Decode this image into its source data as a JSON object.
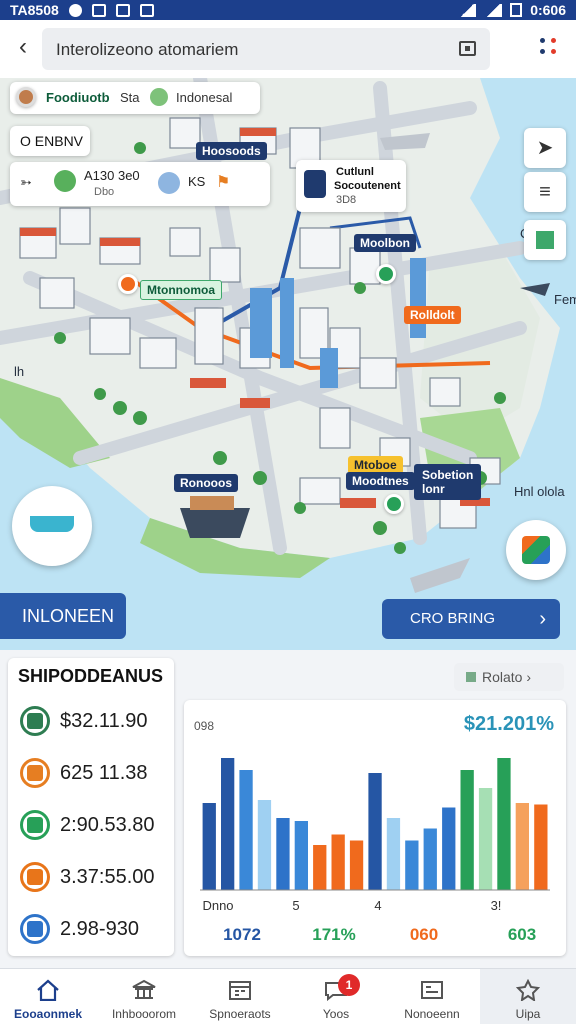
{
  "status_bar": {
    "time": "TA8508",
    "clock": "0:606"
  },
  "search": {
    "title": "Interolizeono atomariem"
  },
  "map": {
    "user_chip": {
      "name": "Foodiuotb",
      "sep": "Sta",
      "place": "Indonesal"
    },
    "filter_chip": "O ENBNV",
    "info_card": {
      "line1": "A130 3e0",
      "sub": "Dbo",
      "code": "KS"
    },
    "poi_card": {
      "title": "Cutlunl",
      "subtitle": "Socoutenent",
      "detail": "3D8"
    },
    "labels": {
      "top": "Hoosoods",
      "green_route": "Mtonnomoa",
      "right_dark": "Moolbon",
      "orange": "Rolldolt",
      "mid_left": "Mtoboe",
      "center_yellow": "Moodtnes",
      "bottom_left": "Ronooos",
      "bottom_card": "Sobetion\nlonr",
      "edge_right_top": "Fem",
      "edge_right_bottom": "Hnl olola",
      "edge_left": "lh",
      "edge_c": "C"
    },
    "region_button": "INLONEEN",
    "go_button": "CRO BRING"
  },
  "dashboard": {
    "title": "SHIPODDEANUS",
    "stats": [
      {
        "value": "$32.11.90",
        "color": "#2e7d52"
      },
      {
        "value": "625 11.38",
        "color": "#e67e22"
      },
      {
        "value": "2:90.53.80",
        "color": "#27a058"
      },
      {
        "value": "3.37:55.00",
        "color": "#e8751a"
      },
      {
        "value": "2.98-930",
        "color": "#2e73c9"
      }
    ],
    "chart_tag": "Rolato"
  },
  "chart_data": {
    "type": "bar",
    "corner_label": "098",
    "headline": "$21.201%",
    "x_labels": [
      "Dnno",
      "5",
      "4",
      "3!"
    ],
    "bottom_values": [
      "1072",
      "171%",
      "060",
      "603"
    ],
    "bars": [
      {
        "value": 58,
        "color": "#2556a4"
      },
      {
        "value": 88,
        "color": "#2556a4"
      },
      {
        "value": 80,
        "color": "#3a88d8"
      },
      {
        "value": 60,
        "color": "#9fd0f2"
      },
      {
        "value": 48,
        "color": "#2e73c9"
      },
      {
        "value": 46,
        "color": "#3a88d8"
      },
      {
        "value": 30,
        "color": "#f06a1d"
      },
      {
        "value": 37,
        "color": "#f06a1d"
      },
      {
        "value": 33,
        "color": "#f06a1d"
      },
      {
        "value": 78,
        "color": "#2556a4"
      },
      {
        "value": 48,
        "color": "#9fd0f2"
      },
      {
        "value": 33,
        "color": "#3a88d8"
      },
      {
        "value": 41,
        "color": "#3a88d8"
      },
      {
        "value": 55,
        "color": "#2e73c9"
      },
      {
        "value": 80,
        "color": "#27a058"
      },
      {
        "value": 68,
        "color": "#a6dfb4"
      },
      {
        "value": 88,
        "color": "#27a058"
      },
      {
        "value": 58,
        "color": "#f5a15c"
      },
      {
        "value": 57,
        "color": "#f06a1d"
      }
    ],
    "ylim": [
      0,
      100
    ],
    "grid": false
  },
  "nav": [
    {
      "label": "Eooaonmek",
      "icon": "home-icon"
    },
    {
      "label": "Inhbooorom",
      "icon": "bank-icon"
    },
    {
      "label": "Spnoeraots",
      "icon": "calendar-icon"
    },
    {
      "label": "Yoos",
      "icon": "chat-icon",
      "badge": "1"
    },
    {
      "label": "Nonoeenn",
      "icon": "profile-card-icon"
    },
    {
      "label": "Uipa",
      "icon": "puzzle-icon"
    }
  ],
  "colors": {
    "primary": "#1c3f8c",
    "accent_orange": "#f06a1d",
    "accent_green": "#27a058",
    "water": "#bde3f4"
  }
}
